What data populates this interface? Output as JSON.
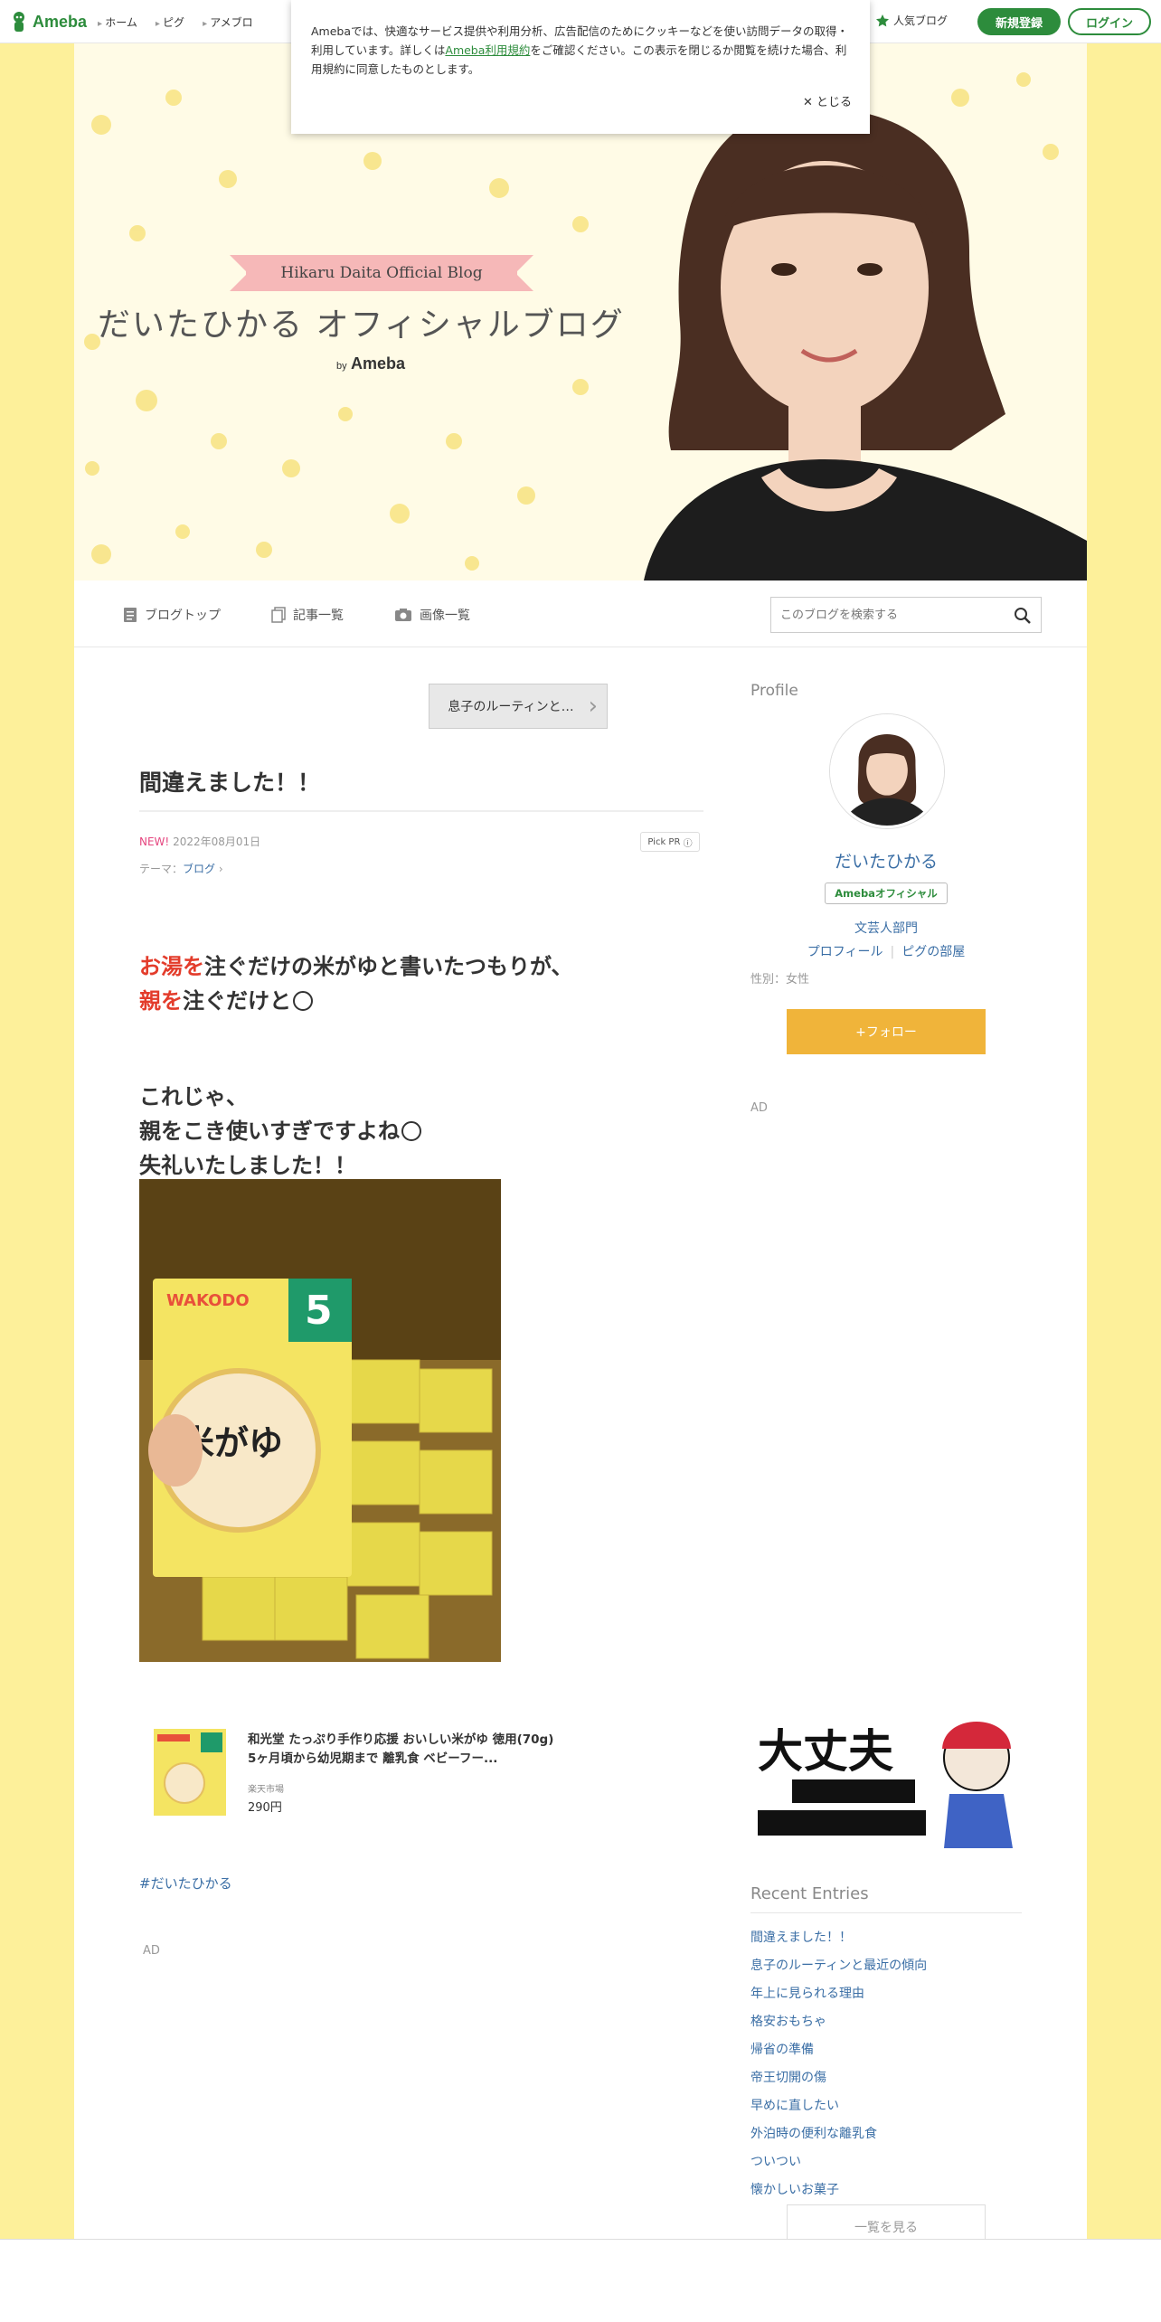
{
  "global_header": {
    "logo_text": "Ameba",
    "nav": [
      "ホーム",
      "ピグ",
      "アメブロ"
    ],
    "popular_blog": "人気ブログ",
    "register_label": "新規登録",
    "login_label": "ログイン",
    "brand_color": "#2d8c3c"
  },
  "cookie_notice": {
    "text_before": "Amebaでは、快適なサービス提供や利用分析、広告配信のためにクッキーなどを使い訪問データの取得・利用しています。詳しくは",
    "link": "Ameba利用規約",
    "text_after": "をご確認ください。この表示を閉じるか閲覧を続けた場合、利用規約に同意したものとします。",
    "close_label": "とじる"
  },
  "hero": {
    "ribbon": "Hikaru Daita Official Blog",
    "title": "だいたひかる オフィシャルブログ",
    "by": "by",
    "brand": "Ameba"
  },
  "blog_nav": {
    "items": [
      "ブログトップ",
      "記事一覧",
      "画像一覧"
    ],
    "search_placeholder": "このブログを検索する"
  },
  "article": {
    "prev_label": "息子のルーティンと…",
    "title": "間違えました！！",
    "new_badge": "NEW!",
    "date": "2022年08月01日",
    "pick_pr": "Pick PR",
    "theme_label": "テーマ：",
    "theme": "ブログ",
    "line1_red": "お湯を",
    "line1_rest": "注ぐだけの米がゆと書いたつもりが、",
    "line2_red": "親を",
    "line2_rest": "注ぐだけと",
    "line3": "これじゃ、",
    "line4": "親をこき使いすぎですよね",
    "line5": "失礼いたしました！！",
    "product_name": "和光堂 たっぷり手作り応援 おいしい米がゆ 徳用(70g) 5ヶ月頃から幼児期まで 離乳食 ベビーフー...",
    "product_shop": "楽天市場",
    "product_price": "290円",
    "hashtag": "#だいたひかる",
    "ad": "AD"
  },
  "sidebar": {
    "profile_heading": "Profile",
    "name": "だいたひかる",
    "official_badge": "Amebaオフィシャル",
    "genre": "文芸人部門",
    "profile_link": "プロフィール",
    "pig_link": "ピグの部屋",
    "gender": "性別：女性",
    "follow_label": "+フォロー",
    "ad": "AD",
    "recent_heading": "Recent Entries",
    "recent_entries": [
      "間違えました！！",
      "息子のルーティンと最近の傾向",
      "年上に見られる理由",
      "格安おもちゃ",
      "帰省の準備",
      "帝王切開の傷",
      "早めに直したい",
      "外泊時の便利な離乳食",
      "ついつい",
      "懐かしいお菓子"
    ],
    "see_all": "一覧を見る"
  }
}
